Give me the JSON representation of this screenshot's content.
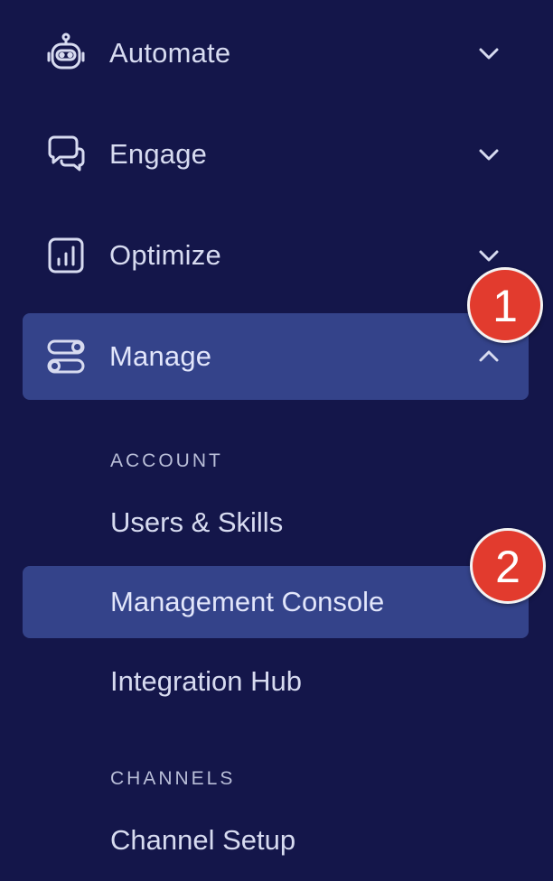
{
  "colors": {
    "background": "#14164a",
    "active_background": "#34438a",
    "text": "#d7dbf0",
    "muted_text": "#b9bed8",
    "marker": "#e23b2e"
  },
  "nav": {
    "items": [
      {
        "label": "Automate",
        "icon": "robot-icon",
        "chevron": "chevron-down-icon",
        "expanded": false
      },
      {
        "label": "Engage",
        "icon": "chat-bubbles-icon",
        "chevron": "chevron-down-icon",
        "expanded": false
      },
      {
        "label": "Optimize",
        "icon": "bar-chart-icon",
        "chevron": "chevron-down-icon",
        "expanded": false
      },
      {
        "label": "Manage",
        "icon": "toggles-icon",
        "chevron": "chevron-up-icon",
        "expanded": true,
        "active": true
      }
    ]
  },
  "manage": {
    "sections": [
      {
        "header": "ACCOUNT",
        "items": [
          {
            "label": "Users & Skills",
            "active": false
          },
          {
            "label": "Management Console",
            "active": true
          },
          {
            "label": "Integration Hub",
            "active": false
          }
        ]
      },
      {
        "header": "CHANNELS",
        "items": [
          {
            "label": "Channel Setup",
            "active": false
          }
        ]
      }
    ]
  },
  "markers": [
    {
      "number": "1"
    },
    {
      "number": "2"
    }
  ]
}
